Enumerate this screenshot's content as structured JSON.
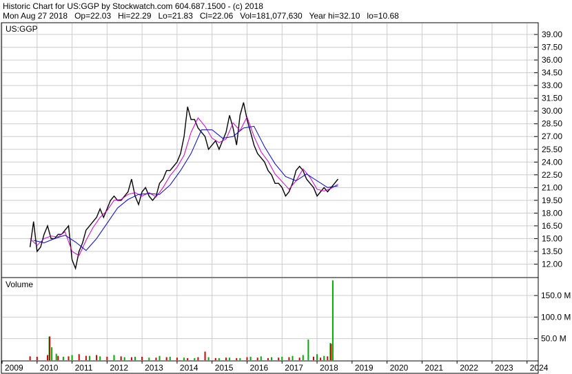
{
  "header": {
    "line1": "Historic Chart for US:GGP by Stockwatch.com 604.687.1500 - (c) 2018",
    "line2": "Mon Aug 27 2018   Op=22.03   Hi=22.29   Lo=21.83   Cl=22.06   Vol=181,077,630   Year hi=32.10   lo=10.68"
  },
  "chart_data": [
    {
      "type": "line",
      "title": "US:GGP",
      "x_range": [
        2009,
        2024.3
      ],
      "ylim": [
        10.5,
        40.3
      ],
      "y_ticks": [
        "39.00",
        "37.50",
        "36.00",
        "34.50",
        "33.00",
        "31.50",
        "30.00",
        "28.50",
        "27.00",
        "25.50",
        "24.00",
        "22.50",
        "21.00",
        "19.50",
        "18.00",
        "16.50",
        "15.00",
        "13.50",
        "12.00"
      ],
      "x_ticks": [
        "2009",
        "2010",
        "2011",
        "2012",
        "2013",
        "2014",
        "2015",
        "2016",
        "2017",
        "2018",
        "2019",
        "2020",
        "2021",
        "2022",
        "2023",
        "2024"
      ],
      "grid": true,
      "series": [
        {
          "color": "#000000",
          "x": [
            2009.8,
            2009.9,
            2010.0,
            2010.1,
            2010.2,
            2010.3,
            2010.4,
            2010.5,
            2010.6,
            2010.7,
            2010.8,
            2010.9,
            2011.0,
            2011.1,
            2011.2,
            2011.3,
            2011.4,
            2011.5,
            2011.6,
            2011.7,
            2011.8,
            2011.9,
            2012.0,
            2012.1,
            2012.2,
            2012.3,
            2012.4,
            2012.5,
            2012.6,
            2012.7,
            2012.8,
            2012.9,
            2013.0,
            2013.1,
            2013.2,
            2013.3,
            2013.4,
            2013.5,
            2013.6,
            2013.7,
            2013.8,
            2013.9,
            2014.0,
            2014.1,
            2014.2,
            2014.3,
            2014.4,
            2014.5,
            2014.6,
            2014.7,
            2014.8,
            2014.9,
            2015.0,
            2015.1,
            2015.2,
            2015.3,
            2015.4,
            2015.5,
            2015.6,
            2015.7,
            2015.8,
            2015.9,
            2016.0,
            2016.1,
            2016.2,
            2016.3,
            2016.4,
            2016.5,
            2016.6,
            2016.7,
            2016.8,
            2016.9,
            2017.0,
            2017.1,
            2017.2,
            2017.3,
            2017.4,
            2017.5,
            2017.6,
            2017.7,
            2017.8,
            2017.9,
            2018.0,
            2018.1,
            2018.2,
            2018.3,
            2018.4,
            2018.5,
            2018.6
          ],
          "values": [
            14.0,
            17.0,
            13.5,
            14.0,
            15.5,
            16.5,
            15.0,
            15.0,
            15.5,
            15.5,
            16.0,
            16.5,
            12.5,
            11.5,
            13.5,
            14.5,
            16.0,
            16.5,
            17.0,
            17.5,
            18.5,
            17.5,
            18.5,
            19.5,
            20.0,
            19.5,
            19.5,
            20.0,
            20.5,
            22.0,
            20.0,
            19.0,
            20.5,
            21.0,
            20.0,
            19.5,
            20.0,
            21.5,
            22.0,
            23.0,
            23.0,
            23.5,
            24.0,
            25.0,
            27.0,
            30.5,
            29.0,
            29.0,
            28.0,
            27.5,
            27.0,
            25.5,
            26.0,
            26.5,
            25.5,
            26.5,
            27.5,
            29.5,
            28.0,
            26.0,
            29.5,
            31.0,
            29.0,
            27.5,
            26.0,
            25.0,
            24.5,
            24.0,
            23.0,
            22.5,
            21.5,
            21.5,
            21.0,
            20.0,
            20.5,
            21.5,
            23.0,
            23.5,
            23.0,
            22.0,
            21.5,
            21.0,
            20.0,
            20.5,
            21.0,
            20.5,
            21.0,
            21.5,
            22.0
          ]
        },
        {
          "color": "#cc00cc",
          "x": [
            2009.8,
            2010.0,
            2010.2,
            2010.4,
            2010.6,
            2010.8,
            2011.0,
            2011.2,
            2011.4,
            2011.6,
            2011.8,
            2012.0,
            2012.2,
            2012.4,
            2012.6,
            2012.8,
            2013.0,
            2013.2,
            2013.4,
            2013.6,
            2013.8,
            2014.0,
            2014.2,
            2014.4,
            2014.6,
            2014.8,
            2015.0,
            2015.2,
            2015.4,
            2015.6,
            2015.8,
            2016.0,
            2016.2,
            2016.4,
            2016.6,
            2016.8,
            2017.0,
            2017.2,
            2017.4,
            2017.6,
            2017.8,
            2018.0,
            2018.2,
            2018.4,
            2018.6
          ],
          "values": [
            15.0,
            14.2,
            15.0,
            15.3,
            15.2,
            15.8,
            13.5,
            13.0,
            14.8,
            16.3,
            17.5,
            18.3,
            19.5,
            19.6,
            20.2,
            20.4,
            20.0,
            20.4,
            19.9,
            21.0,
            22.4,
            23.4,
            24.8,
            27.5,
            29.2,
            28.2,
            26.8,
            26.3,
            26.7,
            28.6,
            27.7,
            29.3,
            27.0,
            25.2,
            24.1,
            22.6,
            21.7,
            20.8,
            21.8,
            23.2,
            22.2,
            20.8,
            20.6,
            20.9,
            21.4
          ]
        },
        {
          "color": "#0000cc",
          "x": [
            2009.9,
            2010.2,
            2010.5,
            2010.8,
            2011.1,
            2011.4,
            2011.7,
            2012.0,
            2012.3,
            2012.6,
            2012.9,
            2013.2,
            2013.5,
            2013.8,
            2014.1,
            2014.4,
            2014.7,
            2015.0,
            2015.3,
            2015.6,
            2015.9,
            2016.2,
            2016.5,
            2016.8,
            2017.1,
            2017.4,
            2017.7,
            2018.0,
            2018.3,
            2018.6
          ],
          "values": [
            14.8,
            14.5,
            15.0,
            15.4,
            14.6,
            13.6,
            15.0,
            16.8,
            18.6,
            19.6,
            20.2,
            20.3,
            20.2,
            21.3,
            23.0,
            25.0,
            27.8,
            27.8,
            26.8,
            27.0,
            28.0,
            28.2,
            25.8,
            23.8,
            22.3,
            21.8,
            22.6,
            21.8,
            21.0,
            21.2
          ]
        }
      ]
    },
    {
      "type": "bar",
      "title": "Volume",
      "x_range": [
        2009,
        2024.3
      ],
      "ylim": [
        0,
        190
      ],
      "y_ticks": [
        "150.0 M",
        "100.0 M",
        "50.0 M"
      ],
      "series": [
        {
          "color": "#00aa00",
          "x": [
            2010.35,
            2010.42,
            2010.55,
            2010.75,
            2011.0,
            2011.5,
            2011.8,
            2012.2,
            2012.5,
            2012.8,
            2013.2,
            2013.5,
            2013.8,
            2014.2,
            2014.5,
            2014.9,
            2015.2,
            2015.5,
            2015.8,
            2016.1,
            2016.4,
            2016.7,
            2017.0,
            2017.3,
            2017.6,
            2017.75,
            2018.0,
            2018.2,
            2018.38,
            2018.45
          ],
          "values": [
            55,
            30,
            15,
            8,
            12,
            10,
            9,
            12,
            7,
            8,
            6,
            10,
            8,
            6,
            5,
            7,
            5,
            6,
            5,
            8,
            9,
            7,
            8,
            10,
            12,
            48,
            14,
            10,
            40,
            185
          ]
        },
        {
          "color": "#cc0000",
          "x": [
            2009.8,
            2010.0,
            2010.3,
            2010.36,
            2010.6,
            2010.9,
            2011.2,
            2011.4,
            2011.7,
            2012.0,
            2012.4,
            2012.7,
            2013.0,
            2013.4,
            2013.7,
            2014.0,
            2014.3,
            2014.6,
            2014.8,
            2015.1,
            2015.4,
            2015.7,
            2016.0,
            2016.3,
            2016.6,
            2016.9,
            2017.2,
            2017.5,
            2017.9,
            2018.1,
            2018.3,
            2018.4
          ],
          "values": [
            9,
            8,
            12,
            55,
            10,
            9,
            14,
            10,
            12,
            8,
            9,
            7,
            8,
            6,
            7,
            6,
            5,
            7,
            20,
            5,
            6,
            5,
            7,
            6,
            5,
            6,
            7,
            6,
            8,
            6,
            9,
            38
          ]
        }
      ]
    }
  ]
}
